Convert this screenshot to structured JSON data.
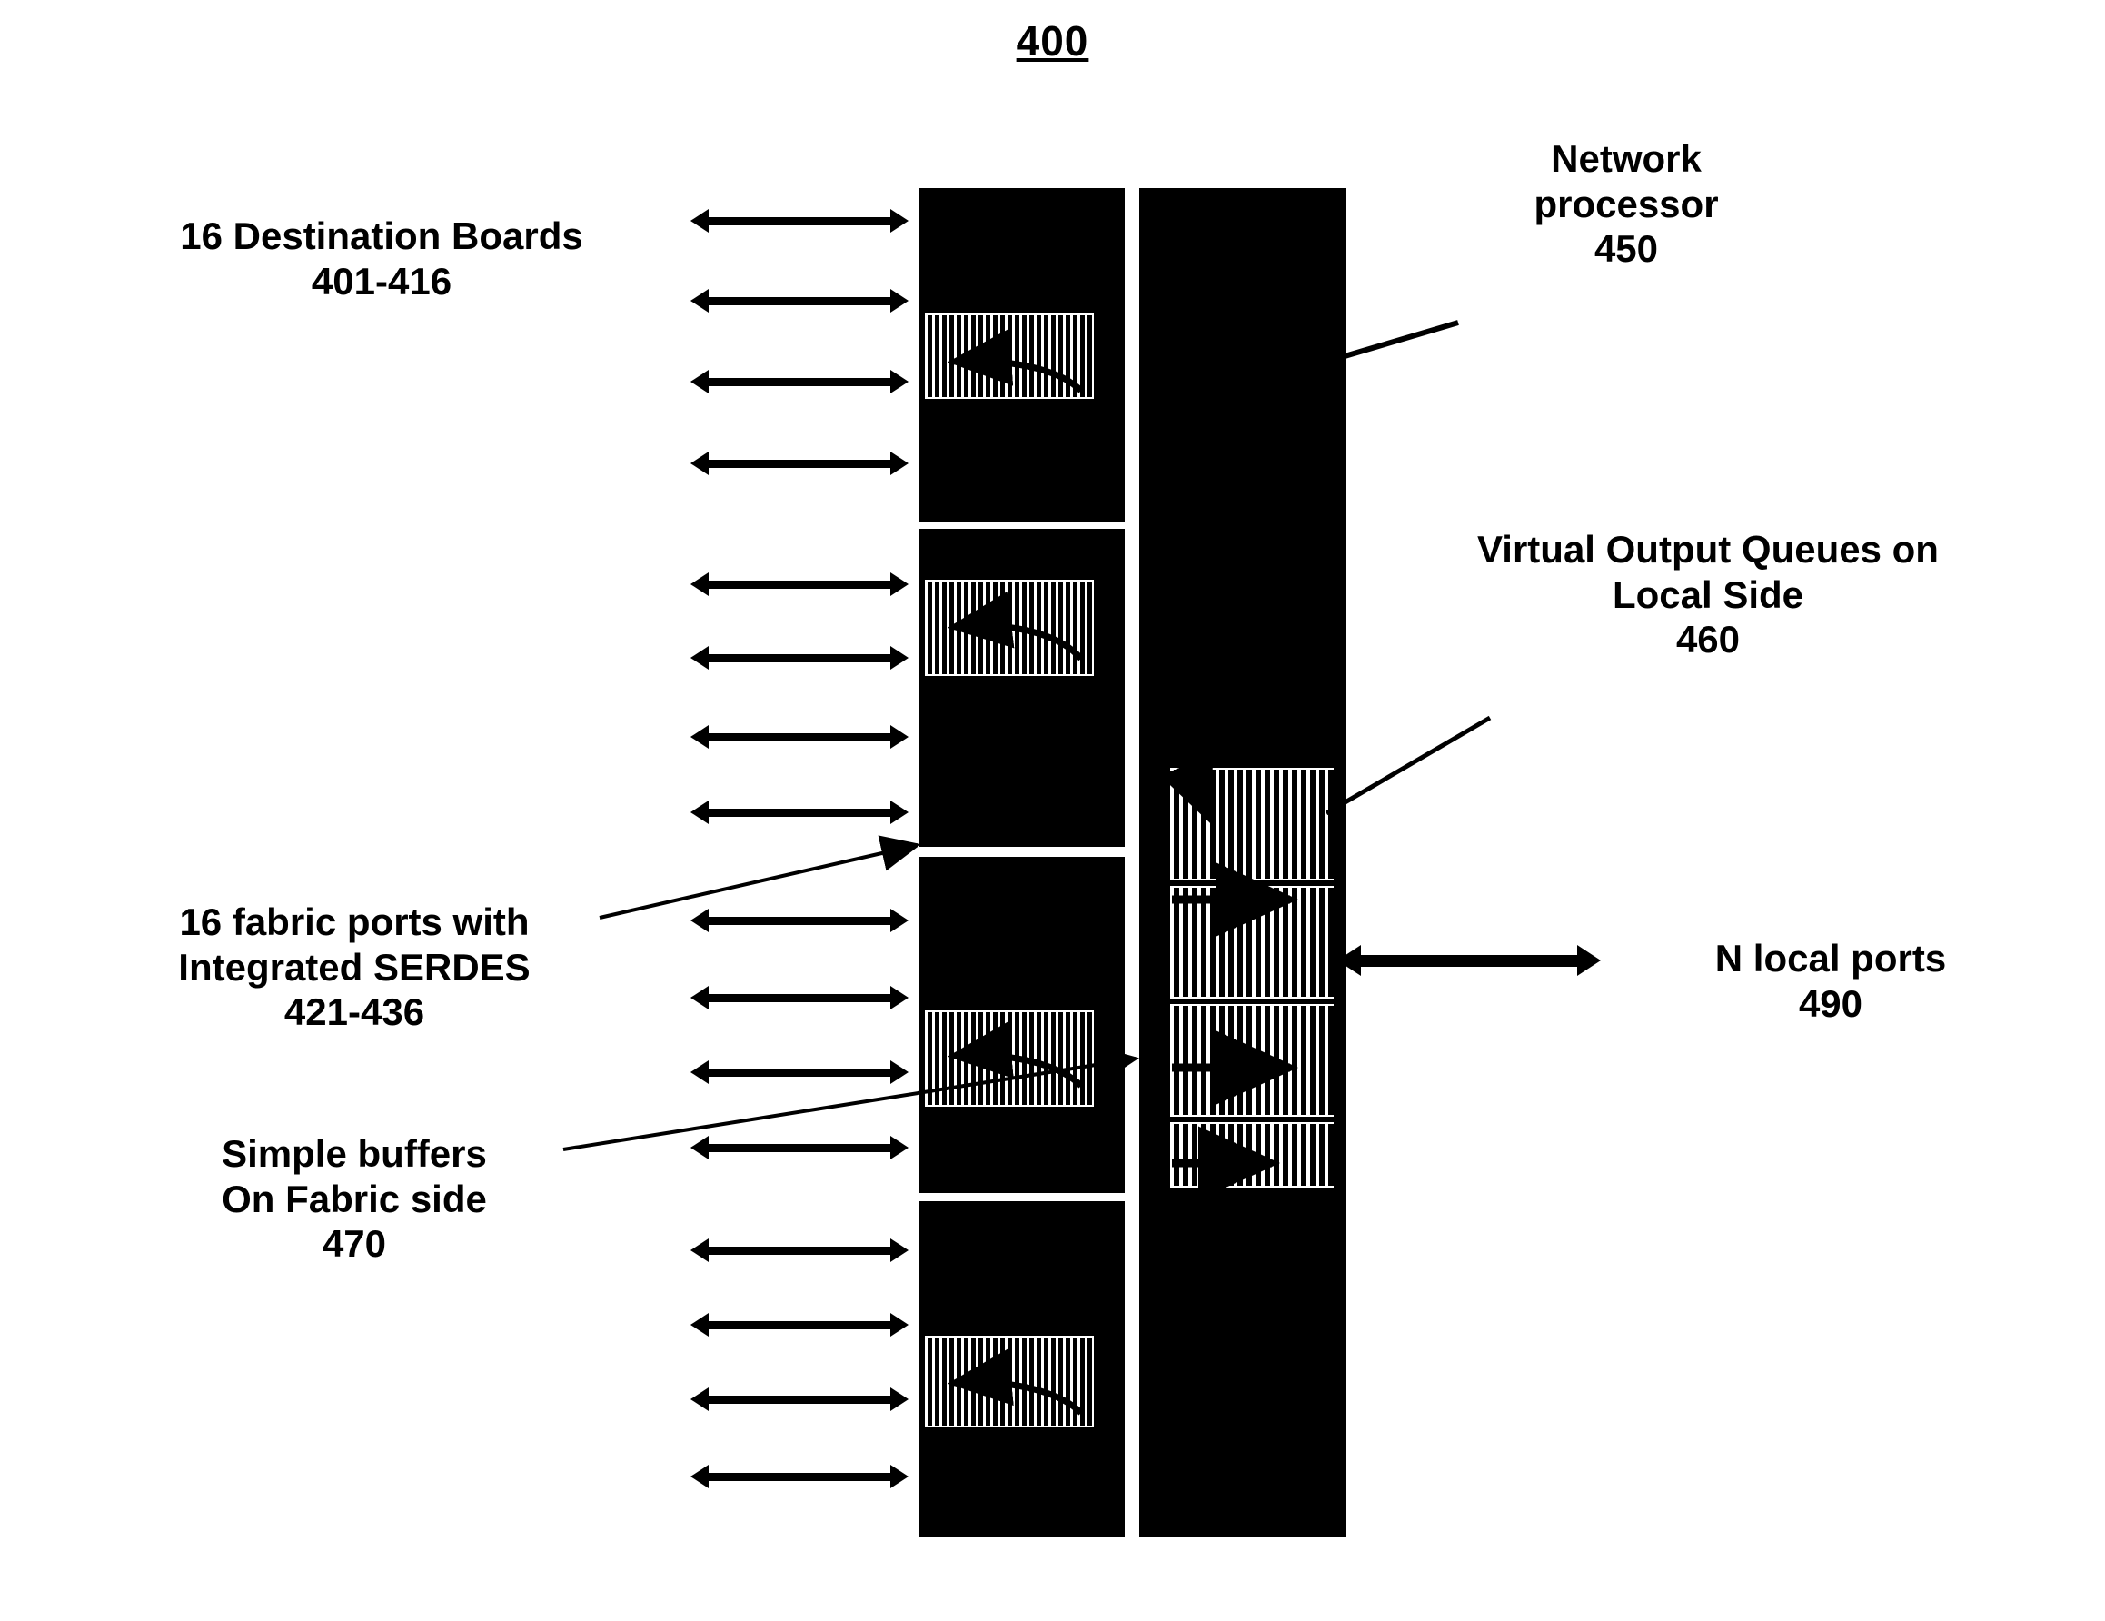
{
  "figure": {
    "number": "400"
  },
  "labels": {
    "destination_boards": "16 Destination Boards\n401-416",
    "fabric_ports": "16 fabric ports with\nIntegrated SERDES\n421-436",
    "simple_buffers": "Simple buffers\nOn Fabric side\n470",
    "network_processor": "Network\nprocessor\n450",
    "virtual_output_queues": "Virtual Output Queues on\nLocal Side\n460",
    "local_ports": "N local ports\n490"
  },
  "diagram": {
    "bus_arrow_count": 16,
    "local_port_arrow": "bidirectional-arrow",
    "fabric_buffer_count": 4,
    "voq_block_count": 4,
    "colors": {
      "ink": "#000000",
      "background": "#ffffff"
    }
  }
}
